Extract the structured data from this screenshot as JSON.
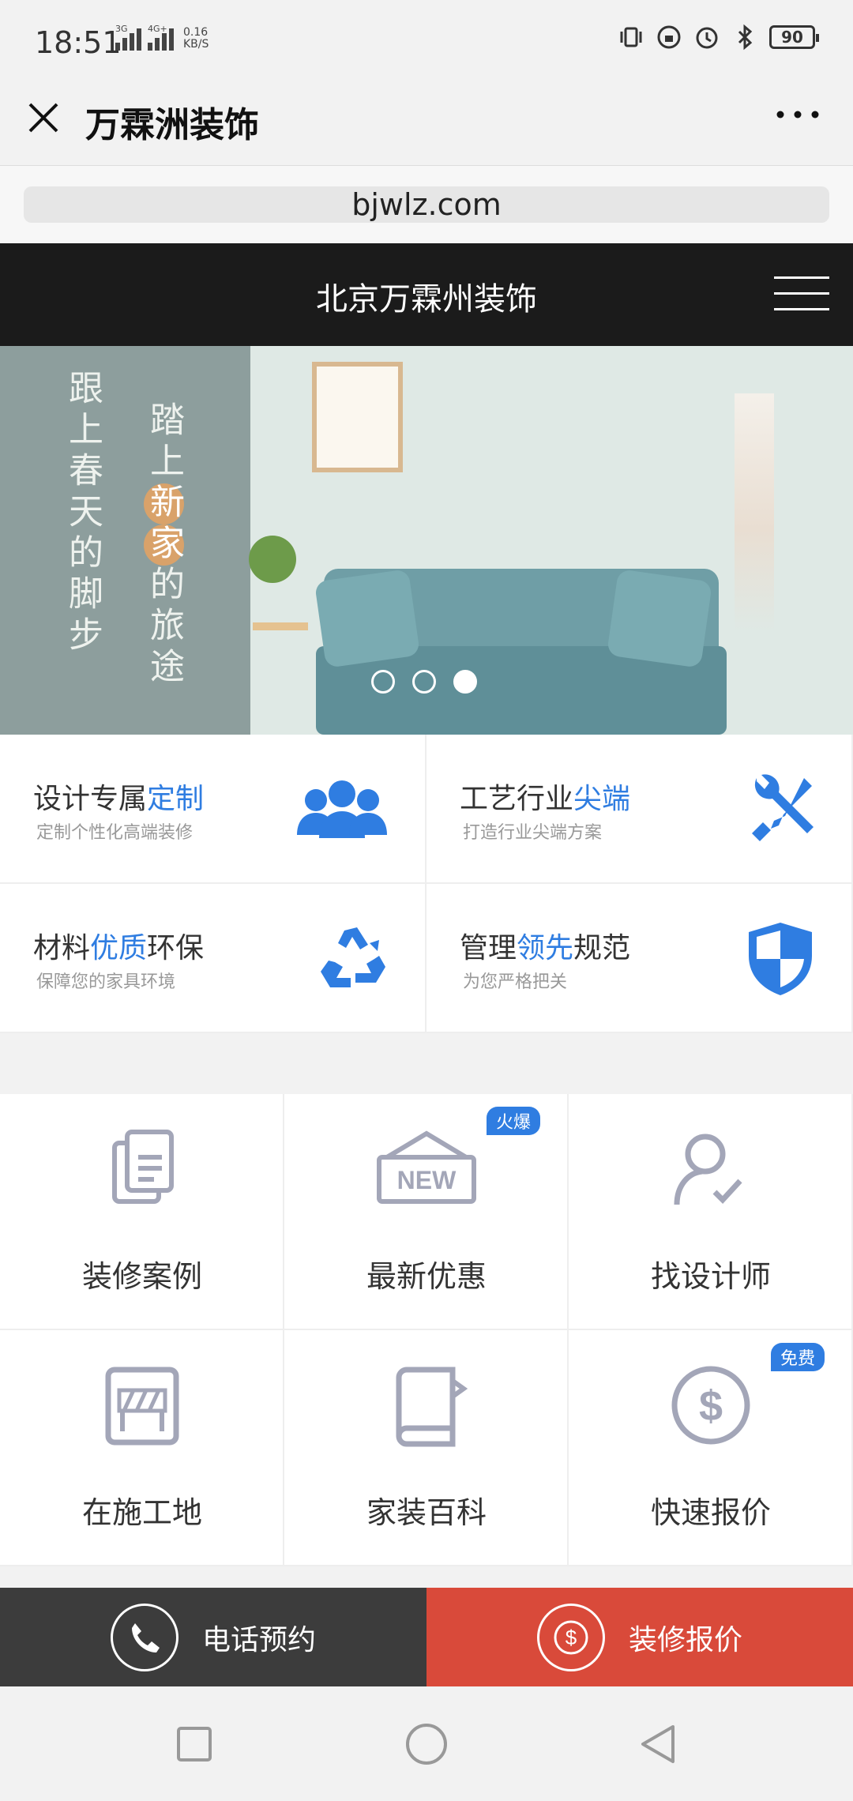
{
  "status_bar": {
    "time": "18:51",
    "net1_label": "3G",
    "net2_label": "4G+",
    "speed_value": "0.16",
    "speed_unit": "KB/S",
    "battery": "90"
  },
  "titlebar": {
    "title": "万霖洲装饰"
  },
  "url_bar": {
    "url": "bjwlz.com"
  },
  "site_header": {
    "title": "北京万霖州装饰"
  },
  "banner": {
    "line1": "跟上春天的脚步",
    "line2_a": "踏上",
    "line2_h1": "新",
    "line2_h2": "家",
    "line2_b": "的旅途",
    "slides_count": 3,
    "active_slide": 3
  },
  "features": [
    {
      "title_a": "设计专属",
      "title_hl": "定制",
      "title_b": "",
      "sub": "定制个性化高端装修",
      "icon": "users-icon"
    },
    {
      "title_a": "工艺行业",
      "title_hl": "尖端",
      "title_b": "",
      "sub": "打造行业尖端方案",
      "icon": "tools-icon"
    },
    {
      "title_a": "材料",
      "title_hl": "优质",
      "title_b": "环保",
      "sub": "保障您的家具环境",
      "icon": "recycle-icon"
    },
    {
      "title_a": "管理",
      "title_hl": "领先",
      "title_b": "规范",
      "sub": "为您严格把关",
      "icon": "shield-icon"
    }
  ],
  "grid": [
    {
      "label": "装修案例",
      "icon": "documents-icon",
      "badge": ""
    },
    {
      "label": "最新优惠",
      "icon": "new-tag-icon",
      "badge": "火爆"
    },
    {
      "label": "找设计师",
      "icon": "designer-icon",
      "badge": ""
    },
    {
      "label": "在施工地",
      "icon": "construction-icon",
      "badge": ""
    },
    {
      "label": "家装百科",
      "icon": "book-icon",
      "badge": ""
    },
    {
      "label": "快速报价",
      "icon": "dollar-icon",
      "badge": "免费"
    }
  ],
  "actions": {
    "phone_label": "电话预约",
    "quote_label": "装修报价"
  },
  "colors": {
    "accent_blue": "#2f7de1",
    "quote_red": "#d94a3a",
    "phone_dark": "#3c3c3c",
    "header_black": "#1b1b1b"
  }
}
